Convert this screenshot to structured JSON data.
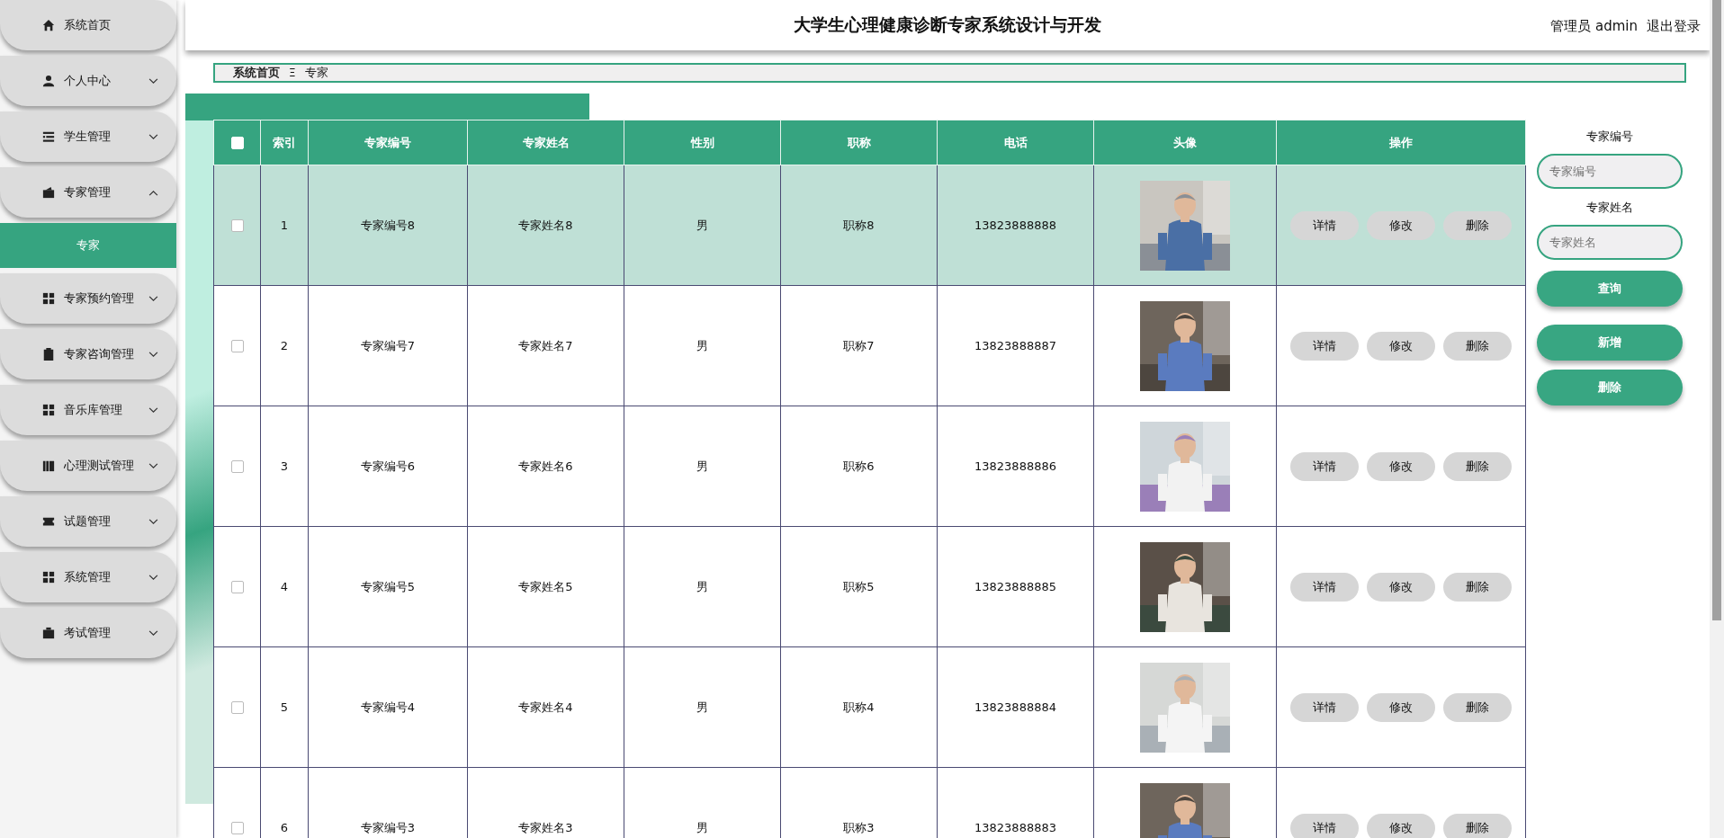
{
  "header": {
    "title": "大学生心理健康诊断专家系统设计与开发",
    "user": "管理员 admin",
    "logout": "退出登录"
  },
  "sidebar": {
    "items": [
      {
        "label": "系统首页"
      },
      {
        "label": "个人中心",
        "expanded": false
      },
      {
        "label": "学生管理",
        "expanded": false
      },
      {
        "label": "专家管理",
        "expanded": true,
        "children": [
          {
            "label": "专家",
            "selected": true
          }
        ]
      },
      {
        "label": "专家预约管理",
        "expanded": false
      },
      {
        "label": "专家咨询管理",
        "expanded": false
      },
      {
        "label": "音乐库管理",
        "expanded": false
      },
      {
        "label": "心理测试管理",
        "expanded": false
      },
      {
        "label": "试题管理",
        "expanded": false
      },
      {
        "label": "系统管理",
        "expanded": false
      },
      {
        "label": "考试管理",
        "expanded": false
      }
    ]
  },
  "breadcrumb": {
    "items": [
      "系统首页",
      "专家"
    ],
    "separator": "Ξ"
  },
  "table": {
    "columns": [
      "索引",
      "专家编号",
      "专家姓名",
      "性别",
      "职称",
      "电话",
      "头像",
      "操作"
    ],
    "all_checked": false,
    "rows": [
      {
        "selected": true,
        "checked": false,
        "index": "1",
        "code": "专家编号8",
        "name": "专家姓名8",
        "gender": "男",
        "title": "职称8",
        "phone": "13823888888",
        "actions": [
          "详情",
          "修改",
          "删除"
        ]
      },
      {
        "selected": false,
        "checked": false,
        "index": "2",
        "code": "专家编号7",
        "name": "专家姓名7",
        "gender": "男",
        "title": "职称7",
        "phone": "13823888887",
        "actions": [
          "详情",
          "修改",
          "删除"
        ]
      },
      {
        "selected": false,
        "checked": false,
        "index": "3",
        "code": "专家编号6",
        "name": "专家姓名6",
        "gender": "男",
        "title": "职称6",
        "phone": "13823888886",
        "actions": [
          "详情",
          "修改",
          "删除"
        ]
      },
      {
        "selected": false,
        "checked": false,
        "index": "4",
        "code": "专家编号5",
        "name": "专家姓名5",
        "gender": "男",
        "title": "职称5",
        "phone": "13823888885",
        "actions": [
          "详情",
          "修改",
          "删除"
        ]
      },
      {
        "selected": false,
        "checked": false,
        "index": "5",
        "code": "专家编号4",
        "name": "专家姓名4",
        "gender": "男",
        "title": "职称4",
        "phone": "13823888884",
        "actions": [
          "详情",
          "修改",
          "删除"
        ]
      },
      {
        "selected": false,
        "checked": false,
        "index": "6",
        "code": "专家编号3",
        "name": "专家姓名3",
        "gender": "男",
        "title": "职称3",
        "phone": "13823888883",
        "actions": [
          "详情",
          "修改",
          "删除"
        ]
      }
    ]
  },
  "search": {
    "fields": [
      {
        "label": "专家编号",
        "placeholder": "专家编号"
      },
      {
        "label": "专家姓名",
        "placeholder": "专家姓名"
      }
    ],
    "query_button": "查询",
    "buttons": [
      "新增",
      "删除"
    ]
  }
}
